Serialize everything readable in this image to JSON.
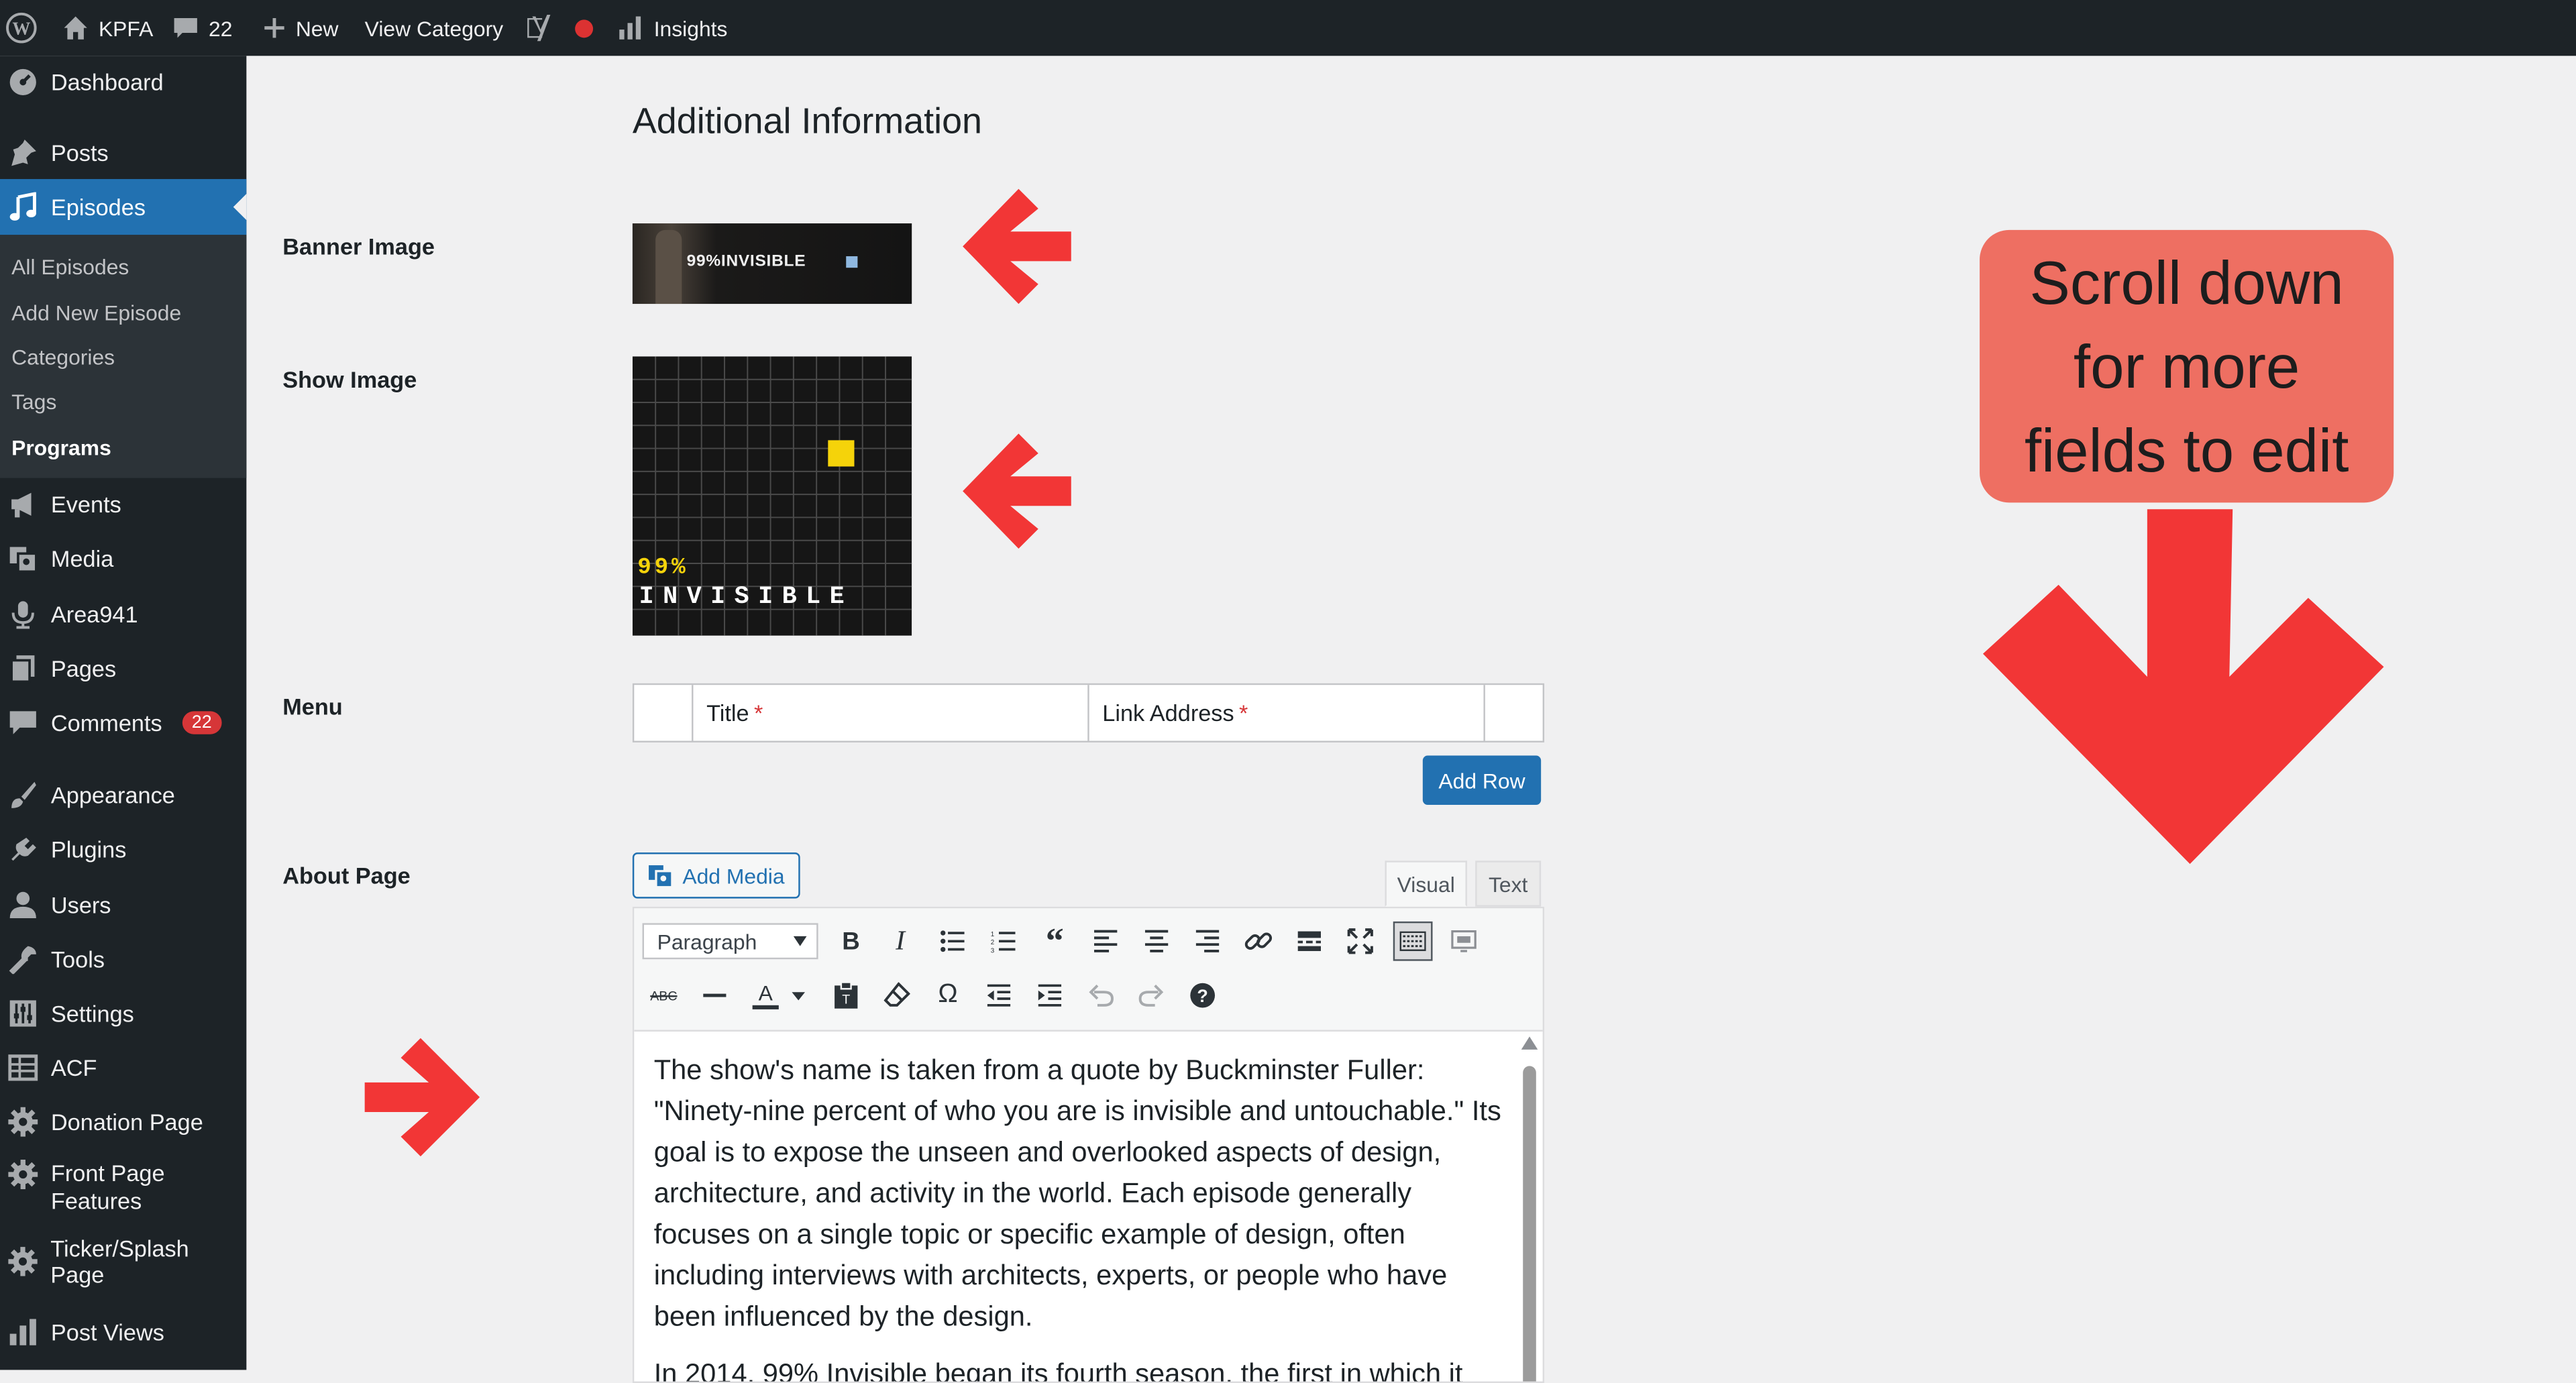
{
  "topbar": {
    "site_name": "KPFA",
    "comments_count": "22",
    "new_label": "New",
    "view_category_label": "View Category",
    "insights_label": "Insights"
  },
  "sidebar": {
    "dashboard": "Dashboard",
    "posts": "Posts",
    "episodes": "Episodes",
    "submenu": [
      "All Episodes",
      "Add New Episode",
      "Categories",
      "Tags",
      "Programs"
    ],
    "events": "Events",
    "media": "Media",
    "area941": "Area941",
    "pages": "Pages",
    "comments": "Comments",
    "comments_badge": "22",
    "appearance": "Appearance",
    "plugins": "Plugins",
    "users": "Users",
    "tools": "Tools",
    "settings": "Settings",
    "acf": "ACF",
    "donation_page": "Donation Page",
    "front_page_1": "Front Page",
    "front_page_2": "Features",
    "ticker": "Ticker/Splash Page",
    "post_views": "Post Views"
  },
  "main": {
    "section_title": "Additional Information",
    "banner_label": "Banner Image",
    "banner_text": "99%INVISIBLE",
    "show_label": "Show Image",
    "show_text_top": "99%",
    "show_text_bottom": "INVISIBLE",
    "menu_label": "Menu",
    "col_title": "Title",
    "col_link": "Link Address",
    "required_mark": "*",
    "add_row": "Add Row",
    "about_label": "About Page",
    "add_media": "Add Media",
    "tab_visual": "Visual",
    "tab_text": "Text",
    "format_select": "Paragraph",
    "paragraphs": [
      "The show's name is taken from a quote by Buckminster Fuller: \"Ninety-nine percent of who you are is invisible and untouchable.\" Its goal is to expose the unseen and overlooked aspects of design, architecture, and activity in the world. Each episode generally focuses on a single topic or specific example of design, often including interviews with architects, experts, or people who have been influenced by the design.",
      "In 2014, 99% Invisible began its fourth season, the first in which it"
    ]
  },
  "callout": {
    "line1": "Scroll down",
    "line2": "for more",
    "line3": "fields to edit"
  },
  "colors": {
    "admin_dark": "#1d2327",
    "accent_blue": "#2271b1",
    "arrow_red": "#f23636",
    "callout_bg": "#ee6f62",
    "show_yellow": "#f5d30a"
  }
}
